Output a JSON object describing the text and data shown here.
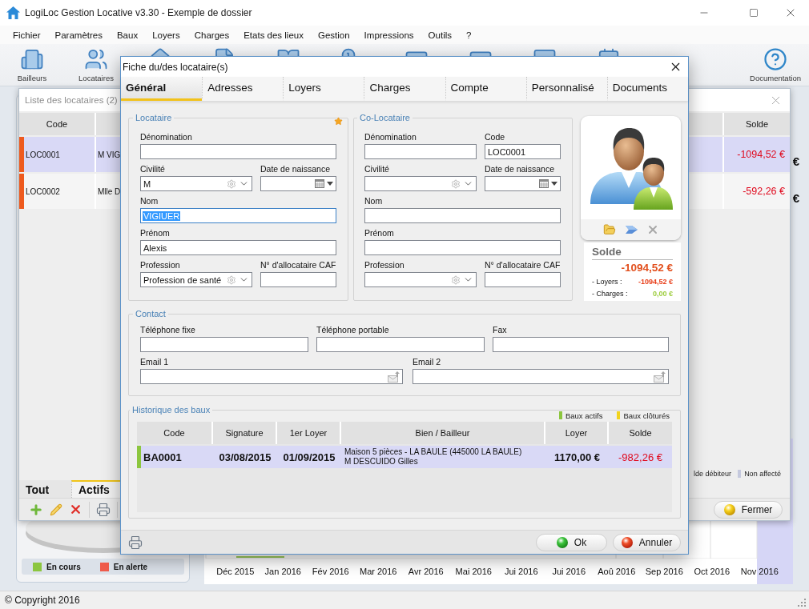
{
  "window": {
    "title": "LogiLoc Gestion Locative v3.30 - Exemple de dossier"
  },
  "menu": [
    "Fichier",
    "Paramètres",
    "Baux",
    "Loyers",
    "Charges",
    "Etats des lieux",
    "Gestion",
    "Impressions",
    "Outils",
    "?"
  ],
  "toolbar": {
    "items": [
      {
        "label": "Bailleurs"
      },
      {
        "label": "Locataires"
      }
    ],
    "help": {
      "label": "Documentation"
    }
  },
  "dashboard": {
    "cells": [
      "€",
      "€"
    ],
    "legend": [
      {
        "label": "En cours",
        "color": "#8cc63f"
      },
      {
        "label": "En alerte",
        "color": "#ef5b4b"
      }
    ],
    "months": [
      "Déc 2015",
      "Jan 2016",
      "Fév 2016",
      "Mar 2016",
      "Avr 2016",
      "Mai 2016",
      "Jui 2016",
      "Jui 2016",
      "Aoû 2016",
      "Sep 2016",
      "Oct 2016",
      "Nov 2016"
    ]
  },
  "tenant_list": {
    "title": "Liste des locataires (2)",
    "columns": [
      {
        "label": "Code"
      },
      {
        "label": "Solde"
      }
    ],
    "rows": [
      {
        "code": "LOC0001",
        "name": "M VIG",
        "balance": "-1094,52 €",
        "color": "#ee5a1e",
        "selected": true
      },
      {
        "code": "LOC0002",
        "name": "Mlle D",
        "balance": "-592,26 €",
        "color": "#ee5a1e",
        "selected": false
      }
    ],
    "legend": [
      {
        "label": "lde débiteur"
      },
      {
        "label": "Non affecté",
        "color": "#c5c9de"
      }
    ],
    "tabs": [
      {
        "label": "Tout",
        "selected": false
      },
      {
        "label": "Actifs",
        "selected": true
      }
    ],
    "close_button": {
      "label": "Fermer",
      "kind": "close"
    }
  },
  "dialog": {
    "title": "Fiche du/des locataire(s)",
    "tabs": [
      {
        "label": "Général",
        "selected": true
      },
      {
        "label": "Adresses",
        "selected": false
      },
      {
        "label": "Loyers",
        "selected": false
      },
      {
        "label": "Charges",
        "selected": false
      },
      {
        "label": "Compte",
        "selected": false
      },
      {
        "label": "Personnalisé",
        "selected": false
      },
      {
        "label": "Documents",
        "selected": false
      }
    ],
    "groups": [
      {
        "title": "Locataire",
        "starred": true,
        "rows": [
          {
            "fields": [
              {
                "label": "Dénomination",
                "kind": "text",
                "focused": false
              }
            ]
          },
          {
            "fields": [
              {
                "label": "Civilité",
                "kind": "select",
                "value": "M",
                "focused": false
              },
              {
                "label": "Date de naissance",
                "kind": "date",
                "focused": false
              }
            ]
          },
          {
            "fields": [
              {
                "label": "Nom",
                "kind": "text",
                "value": "VIGIUER",
                "focused": true
              }
            ]
          },
          {
            "fields": [
              {
                "label": "Prénom",
                "kind": "text",
                "value": "Alexis",
                "focused": false
              }
            ]
          },
          {
            "fields": [
              {
                "label": "Profession",
                "kind": "select",
                "value": "Profession de santé",
                "focused": false
              },
              {
                "label": "N° d'allocataire CAF",
                "kind": "text",
                "focused": false
              }
            ]
          }
        ]
      },
      {
        "title": "Co-Locataire",
        "starred": false,
        "rows": [
          {
            "fields": [
              {
                "label": "Dénomination",
                "kind": "text",
                "focused": false
              },
              {
                "label": "Code",
                "kind": "text",
                "value": "LOC0001",
                "focused": false
              }
            ]
          },
          {
            "fields": [
              {
                "label": "Civilité",
                "kind": "select",
                "focused": false
              },
              {
                "label": "Date de naissance",
                "kind": "date",
                "focused": false
              }
            ]
          },
          {
            "fields": [
              {
                "label": "Nom",
                "kind": "text",
                "focused": false
              }
            ]
          },
          {
            "fields": [
              {
                "label": "Prénom",
                "kind": "text",
                "focused": false
              }
            ]
          },
          {
            "fields": [
              {
                "label": "Profession",
                "kind": "select",
                "focused": false
              },
              {
                "label": "N° d'allocataire CAF",
                "kind": "text",
                "focused": false
              }
            ]
          }
        ]
      }
    ],
    "balance": {
      "title": "Solde",
      "amount": "-1094,52 €",
      "lines": [
        {
          "label": "- Loyers :",
          "value": "-1094,52 €",
          "color": "#e8401c"
        },
        {
          "label": "- Charges :",
          "value": "0,00 €",
          "color": "#9ccc3c"
        }
      ]
    },
    "contact": {
      "title": "Contact",
      "rows": [
        {
          "fields": [
            {
              "label": "Téléphone fixe",
              "kind": "text",
              "focused": false
            },
            {
              "label": "Téléphone portable",
              "kind": "text",
              "focused": false
            },
            {
              "label": "Fax",
              "kind": "text",
              "focused": false
            }
          ]
        },
        {
          "fields": [
            {
              "label": "Email 1",
              "kind": "email",
              "focused": false
            },
            {
              "label": "Email 2",
              "kind": "email",
              "focused": false
            }
          ]
        }
      ]
    },
    "history": {
      "title": "Historique des baux",
      "legend": [
        {
          "label": "Baux actifs",
          "color": "#8cc63f"
        },
        {
          "label": "Baux clôturés",
          "color": "#f2d41e"
        }
      ],
      "columns": [
        "Code",
        "Signature",
        "1er Loyer",
        "Bien / Bailleur",
        "Loyer",
        "Solde"
      ],
      "rows": [
        {
          "code": "BA0001",
          "signature": "03/08/2015",
          "first_rent": "01/09/2015",
          "property": "Maison 5 pièces - LA BAULE (445000 LA BAULE)",
          "landlord": "M DESCUIDO Gilles",
          "rent": "1170,00 €",
          "balance": "-982,26 €",
          "color": "#8cc63f",
          "selected": true
        }
      ]
    },
    "buttons": [
      {
        "label": "Ok",
        "kind": "ok"
      },
      {
        "label": "Annuler",
        "kind": "cancel"
      }
    ]
  },
  "status_bar": {
    "text": "© Copyright 2016"
  }
}
